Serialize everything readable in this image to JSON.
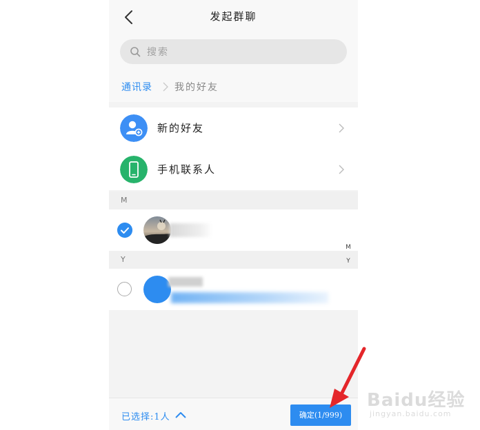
{
  "header": {
    "title": "发起群聊",
    "back_icon": "chevron-left-icon"
  },
  "search": {
    "placeholder": "搜索",
    "icon": "search-icon"
  },
  "breadcrumb": {
    "items": [
      "通讯录",
      "我的好友"
    ]
  },
  "menu": [
    {
      "label": "新的好友",
      "icon": "add-user-icon",
      "color": "#3d8ff5"
    },
    {
      "label": "手机联系人",
      "icon": "phone-icon",
      "color": "#27b36b"
    }
  ],
  "sections": [
    {
      "letter": "M",
      "contacts": [
        {
          "selected": true
        }
      ]
    },
    {
      "letter": "Y",
      "contacts": [
        {
          "selected": false
        }
      ]
    }
  ],
  "index_bar": [
    "M",
    "Y"
  ],
  "footer": {
    "selected_text": "已选择:1人",
    "confirm_label": "确定(1/999)"
  },
  "watermark": {
    "logo": "Baidu经验",
    "url": "jingyan.baidu.com"
  },
  "colors": {
    "accent": "#2d8cf0",
    "annotation_arrow": "#e4262a"
  }
}
